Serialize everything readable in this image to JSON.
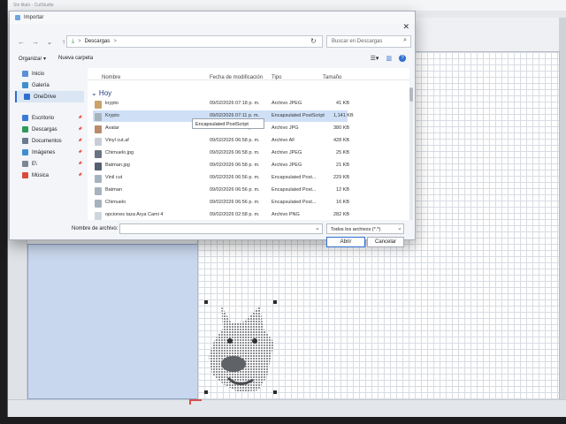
{
  "app": {
    "title": "Sin titulo - CutStudio"
  },
  "dialog": {
    "title": "Importar",
    "close_glyph": "✕",
    "nav": {
      "back": "←",
      "forward": "→",
      "down": "⌄",
      "up": "↑"
    },
    "address": {
      "path": "Descargas",
      "sep": ">"
    },
    "search": {
      "placeholder": "Buscar en Descargas",
      "icon": "⌕"
    },
    "toolbar": {
      "organize": "Organizar ▾",
      "new_folder": "Nueva carpeta"
    },
    "sidebar": [
      {
        "label": "Inicio",
        "icon": "home-icon",
        "color": "#5b8fd8"
      },
      {
        "label": "Galería",
        "icon": "gallery-icon",
        "color": "#3f8fcf"
      },
      {
        "label": "OneDrive",
        "icon": "cloud-icon",
        "color": "#2f6fd1",
        "selected": true
      },
      {
        "label": "Escritorio",
        "icon": "desktop-icon",
        "color": "#3a7bd5",
        "pinned": true
      },
      {
        "label": "Descargas",
        "icon": "download-icon",
        "color": "#2f9a5a",
        "pinned": true
      },
      {
        "label": "Documentos",
        "icon": "documents-icon",
        "color": "#6b7a8f",
        "pinned": true
      },
      {
        "label": "Imágenes",
        "icon": "images-icon",
        "color": "#3f8fcf",
        "pinned": true
      },
      {
        "label": "E\\",
        "icon": "drive-icon",
        "color": "#7b8794",
        "pinned": true
      },
      {
        "label": "Música",
        "icon": "music-icon",
        "color": "#d84b3b",
        "pinned": true
      }
    ],
    "columns": {
      "name": "Nombre",
      "date": "Fecha de modificación",
      "type": "Tipo",
      "size": "Tamaño"
    },
    "group": "⌄ Hoy",
    "files": [
      {
        "name": "krypto",
        "date": "09/02/2026 07:18 p. m.",
        "type": "Archivo JPEG",
        "size": "41 KB",
        "color": "#c9a36a"
      },
      {
        "name": "Krypto",
        "date": "09/02/2026 07:11 p. m.",
        "type": "Encapsulated PostScript",
        "size": "1,141 KB",
        "color": "#a7b2bf",
        "selected": true
      },
      {
        "name": "Avatar",
        "date": "09/02/2026 07:02 p. m.",
        "type": "Archivo JPG",
        "size": "380 KB",
        "color": "#b98a6b"
      },
      {
        "name": "Vinyl cut.af",
        "date": "09/02/2026 06:58 p. m.",
        "type": "Archivo AF",
        "size": "428 KB",
        "color": "#c8ced6"
      },
      {
        "name": "Chimuelo.jpg",
        "date": "09/02/2026 06:58 p. m.",
        "type": "Archivo JPEG",
        "size": "25 KB",
        "color": "#6a7582"
      },
      {
        "name": "Batman.jpg",
        "date": "09/02/2026 06:58 p. m.",
        "type": "Archivo JPEG",
        "size": "21 KB",
        "color": "#54606d"
      },
      {
        "name": "Vinil cut",
        "date": "09/02/2026 06:56 p. m.",
        "type": "Encapsulated Post...",
        "size": "229 KB",
        "color": "#a7b2bf"
      },
      {
        "name": "Batman",
        "date": "09/02/2026 06:56 p. m.",
        "type": "Encapsulated Post...",
        "size": "12 KB",
        "color": "#a7b2bf"
      },
      {
        "name": "Chimuelo",
        "date": "09/02/2026 06:56 p. m.",
        "type": "Encapsulated Post...",
        "size": "16 KB",
        "color": "#a7b2bf"
      },
      {
        "name": "opciones taza Arya Cami 4",
        "date": "09/02/2026 02:58 p. m.",
        "type": "Archivo PNG",
        "size": "282 KB",
        "color": "#cfd6de"
      }
    ],
    "tooltip": "Encapsulated PostScript",
    "filename_label": "Nombre de archivo:",
    "filename_value": "",
    "filetype": "Todos los archivos (*.*)",
    "open_button": "Abrir",
    "cancel_button": "Cancelar"
  }
}
